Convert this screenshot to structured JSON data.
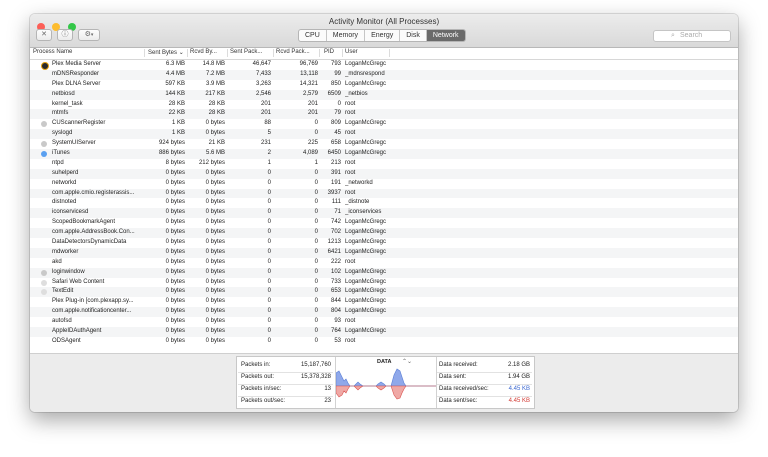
{
  "window": {
    "title": "Activity Monitor (All Processes)",
    "traffic_lights": [
      "#fc5f57",
      "#fdbc2e",
      "#33c748"
    ]
  },
  "toolbar": {
    "close_process_icon": "x-circle-icon",
    "info_icon": "info-icon",
    "gear_icon": "gear-icon",
    "tabs": [
      "CPU",
      "Memory",
      "Energy",
      "Disk",
      "Network"
    ],
    "active_tab": "Network",
    "search_placeholder": "Search"
  },
  "columns": [
    "Process Name",
    "Sent Bytes",
    "Rcvd By...",
    "Sent Pack...",
    "Rcvd Pack...",
    "PID",
    "User"
  ],
  "processes": [
    {
      "name": "Plex Media Server",
      "sent": "6.3 MB",
      "rcvd": "14.8 MB",
      "spk": "46,647",
      "rpk": "96,769",
      "pid": "793",
      "user": "LoganMcGregc",
      "icon": "plex"
    },
    {
      "name": "mDNSResponder",
      "sent": "4.4 MB",
      "rcvd": "7.2 MB",
      "spk": "7,433",
      "rpk": "13,118",
      "pid": "99",
      "user": "_mdnsrespond",
      "icon": ""
    },
    {
      "name": "Plex DLNA Server",
      "sent": "597 KB",
      "rcvd": "3.9 MB",
      "spk": "3,263",
      "rpk": "14,321",
      "pid": "850",
      "user": "LoganMcGregc",
      "icon": ""
    },
    {
      "name": "netbiosd",
      "sent": "144 KB",
      "rcvd": "217 KB",
      "spk": "2,546",
      "rpk": "2,579",
      "pid": "6509",
      "user": "_netbios",
      "icon": ""
    },
    {
      "name": "kernel_task",
      "sent": "28 KB",
      "rcvd": "28 KB",
      "spk": "201",
      "rpk": "201",
      "pid": "0",
      "user": "root",
      "icon": ""
    },
    {
      "name": "mtmfs",
      "sent": "22 KB",
      "rcvd": "28 KB",
      "spk": "201",
      "rpk": "201",
      "pid": "79",
      "user": "root",
      "icon": ""
    },
    {
      "name": "CUScannerRegister",
      "sent": "1 KB",
      "rcvd": "0 bytes",
      "spk": "88",
      "rpk": "0",
      "pid": "809",
      "user": "LoganMcGregc",
      "icon": "app"
    },
    {
      "name": "syslogd",
      "sent": "1 KB",
      "rcvd": "0 bytes",
      "spk": "5",
      "rpk": "0",
      "pid": "45",
      "user": "root",
      "icon": ""
    },
    {
      "name": "SystemUIServer",
      "sent": "924 bytes",
      "rcvd": "21 KB",
      "spk": "231",
      "rpk": "225",
      "pid": "658",
      "user": "LoganMcGregc",
      "icon": "app"
    },
    {
      "name": "iTunes",
      "sent": "886 bytes",
      "rcvd": "5.6 MB",
      "spk": "2",
      "rpk": "4,089",
      "pid": "6450",
      "user": "LoganMcGregc",
      "icon": "itunes"
    },
    {
      "name": "ntpd",
      "sent": "8 bytes",
      "rcvd": "212 bytes",
      "spk": "1",
      "rpk": "1",
      "pid": "213",
      "user": "root",
      "icon": ""
    },
    {
      "name": "suhelperd",
      "sent": "0 bytes",
      "rcvd": "0 bytes",
      "spk": "0",
      "rpk": "0",
      "pid": "391",
      "user": "root",
      "icon": ""
    },
    {
      "name": "networkd",
      "sent": "0 bytes",
      "rcvd": "0 bytes",
      "spk": "0",
      "rpk": "0",
      "pid": "191",
      "user": "_networkd",
      "icon": ""
    },
    {
      "name": "com.apple.cmio.registerassis...",
      "sent": "0 bytes",
      "rcvd": "0 bytes",
      "spk": "0",
      "rpk": "0",
      "pid": "3937",
      "user": "root",
      "icon": ""
    },
    {
      "name": "distnoted",
      "sent": "0 bytes",
      "rcvd": "0 bytes",
      "spk": "0",
      "rpk": "0",
      "pid": "111",
      "user": "_distnote",
      "icon": ""
    },
    {
      "name": "iconservicesd",
      "sent": "0 bytes",
      "rcvd": "0 bytes",
      "spk": "0",
      "rpk": "0",
      "pid": "71",
      "user": "_iconservices",
      "icon": ""
    },
    {
      "name": "ScopedBookmarkAgent",
      "sent": "0 bytes",
      "rcvd": "0 bytes",
      "spk": "0",
      "rpk": "0",
      "pid": "742",
      "user": "LoganMcGregc",
      "icon": ""
    },
    {
      "name": "com.apple.AddressBook.Con...",
      "sent": "0 bytes",
      "rcvd": "0 bytes",
      "spk": "0",
      "rpk": "0",
      "pid": "702",
      "user": "LoganMcGregc",
      "icon": ""
    },
    {
      "name": "DataDetectorsDynamicData",
      "sent": "0 bytes",
      "rcvd": "0 bytes",
      "spk": "0",
      "rpk": "0",
      "pid": "1213",
      "user": "LoganMcGregc",
      "icon": ""
    },
    {
      "name": "mdworker",
      "sent": "0 bytes",
      "rcvd": "0 bytes",
      "spk": "0",
      "rpk": "0",
      "pid": "6421",
      "user": "LoganMcGregc",
      "icon": ""
    },
    {
      "name": "akd",
      "sent": "0 bytes",
      "rcvd": "0 bytes",
      "spk": "0",
      "rpk": "0",
      "pid": "222",
      "user": "root",
      "icon": ""
    },
    {
      "name": "loginwindow",
      "sent": "0 bytes",
      "rcvd": "0 bytes",
      "spk": "0",
      "rpk": "0",
      "pid": "102",
      "user": "LoganMcGregc",
      "icon": "app"
    },
    {
      "name": "Safari Web Content",
      "sent": "0 bytes",
      "rcvd": "0 bytes",
      "spk": "0",
      "rpk": "0",
      "pid": "733",
      "user": "LoganMcGregc",
      "icon": "doc"
    },
    {
      "name": "TextEdit",
      "sent": "0 bytes",
      "rcvd": "0 bytes",
      "spk": "0",
      "rpk": "0",
      "pid": "653",
      "user": "LoganMcGregc",
      "icon": "doc"
    },
    {
      "name": "Plex Plug-in [com.plexapp.sy...",
      "sent": "0 bytes",
      "rcvd": "0 bytes",
      "spk": "0",
      "rpk": "0",
      "pid": "844",
      "user": "LoganMcGregc",
      "icon": ""
    },
    {
      "name": "com.apple.notificationcenter...",
      "sent": "0 bytes",
      "rcvd": "0 bytes",
      "spk": "0",
      "rpk": "0",
      "pid": "804",
      "user": "LoganMcGregc",
      "icon": ""
    },
    {
      "name": "autofsd",
      "sent": "0 bytes",
      "rcvd": "0 bytes",
      "spk": "0",
      "rpk": "0",
      "pid": "93",
      "user": "root",
      "icon": ""
    },
    {
      "name": "AppleIDAuthAgent",
      "sent": "0 bytes",
      "rcvd": "0 bytes",
      "spk": "0",
      "rpk": "0",
      "pid": "764",
      "user": "LoganMcGregc",
      "icon": ""
    },
    {
      "name": "ODSAgent",
      "sent": "0 bytes",
      "rcvd": "0 bytes",
      "spk": "0",
      "rpk": "0",
      "pid": "53",
      "user": "root",
      "icon": ""
    }
  ],
  "stats_left": [
    {
      "label": "Packets in:",
      "value": "15,187,760"
    },
    {
      "label": "Packets out:",
      "value": "15,378,328"
    },
    {
      "label": "Packets in/sec:",
      "value": "13"
    },
    {
      "label": "Packets out/sec:",
      "value": "23"
    }
  ],
  "graph": {
    "label": "DATA",
    "in_color": "#5b7fd6",
    "out_color": "#d9534f"
  },
  "stats_right": [
    {
      "label": "Data received:",
      "value": "2.18 GB",
      "color": "#222"
    },
    {
      "label": "Data sent:",
      "value": "1.94 GB",
      "color": "#222"
    },
    {
      "label": "Data received/sec:",
      "value": "4.45 KB",
      "color": "#3a67d0"
    },
    {
      "label": "Data sent/sec:",
      "value": "4.45 KB",
      "color": "#d23a34"
    }
  ]
}
